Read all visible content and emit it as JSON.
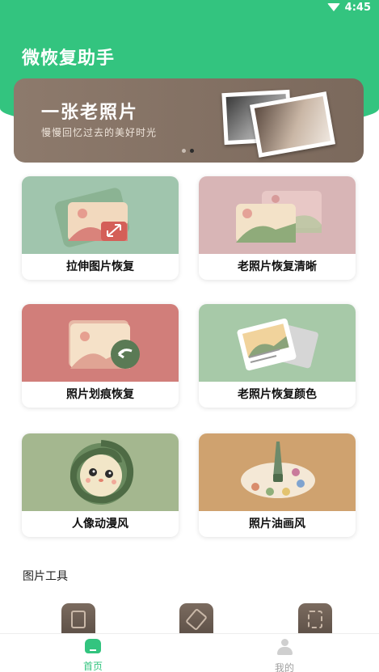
{
  "status_bar": {
    "time": "4:45"
  },
  "app": {
    "title": "微恢复助手"
  },
  "banner": {
    "title": "一张老照片",
    "subtitle": "慢慢回忆过去的美好时光",
    "page_count": 2,
    "active_page": 2
  },
  "features": [
    {
      "label": "拉伸图片恢复",
      "icon": "stretch-image-icon",
      "color": "#a9cdb8"
    },
    {
      "label": "老照片恢复清晰",
      "icon": "old-photo-clarity-icon",
      "color": "#d8b5b6"
    },
    {
      "label": "照片划痕恢复",
      "icon": "scratch-repair-icon",
      "color": "#d78985"
    },
    {
      "label": "老照片恢复颜色",
      "icon": "colorize-photo-icon",
      "color": "#a7c9a8"
    },
    {
      "label": "人像动漫风",
      "icon": "anime-portrait-icon",
      "color": "#a4b78f"
    },
    {
      "label": "照片油画风",
      "icon": "oil-painting-icon",
      "color": "#cfa26f"
    }
  ],
  "tools_section": {
    "title": "图片工具",
    "tools": [
      {
        "icon": "notebook-tool-icon"
      },
      {
        "icon": "eraser-tool-icon"
      },
      {
        "icon": "convert-tool-icon"
      }
    ]
  },
  "tabbar": {
    "home_label": "首页",
    "mine_label": "我的",
    "active_color": "#33c47f",
    "inactive_color": "#a0a0a0"
  }
}
